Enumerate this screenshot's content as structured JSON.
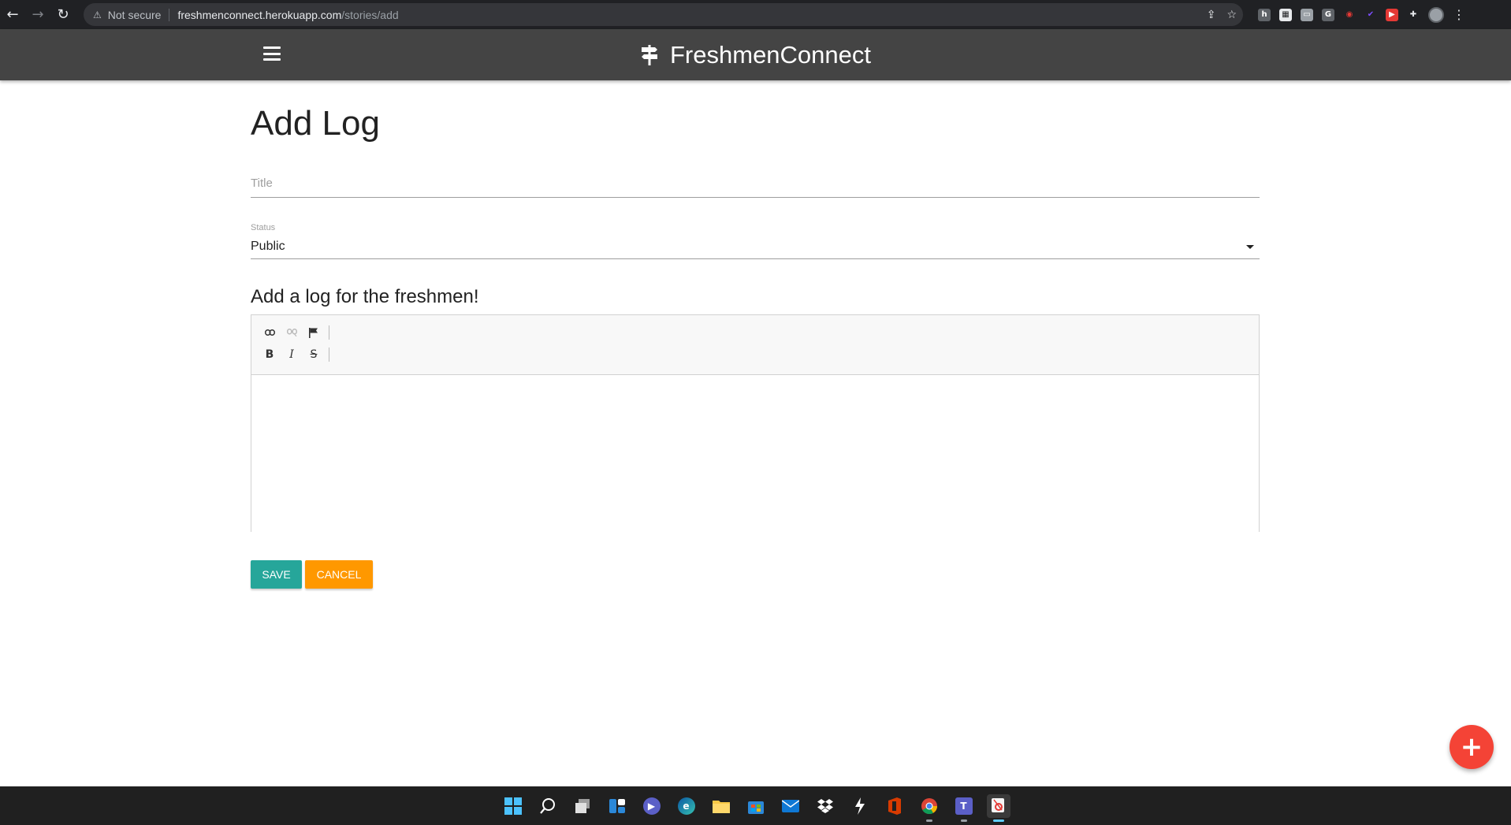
{
  "browser": {
    "security_label": "Not secure",
    "url_domain": "freshmenconnect.herokuapp.com",
    "url_path": "/stories/add"
  },
  "navbar": {
    "brand": "FreshmenConnect"
  },
  "page": {
    "title": "Add Log",
    "title_field_placeholder": "Title",
    "status_label": "Status",
    "status_value": "Public",
    "editor_heading": "Add a log for the freshmen!",
    "save_label": "SAVE",
    "cancel_label": "CANCEL",
    "fab_label": "+"
  },
  "editor_toolbar": {
    "row1": [
      "link-icon",
      "unlink-icon",
      "flag-icon"
    ],
    "row2": [
      "B",
      "I",
      "S"
    ]
  },
  "colors": {
    "navbar_bg": "#444444",
    "save_button": "#26a69a",
    "cancel_button": "#ff9800",
    "fab": "#f44336"
  },
  "taskbar": {
    "apps": [
      "windows-start-icon",
      "search-icon",
      "task-view-icon",
      "widgets-icon",
      "teams-chat-icon",
      "edge-icon",
      "file-explorer-icon",
      "store-icon",
      "mail-icon",
      "dropbox-icon",
      "app-icon",
      "office-icon",
      "chrome-icon",
      "teams-icon",
      "snipping-tool-icon"
    ]
  }
}
